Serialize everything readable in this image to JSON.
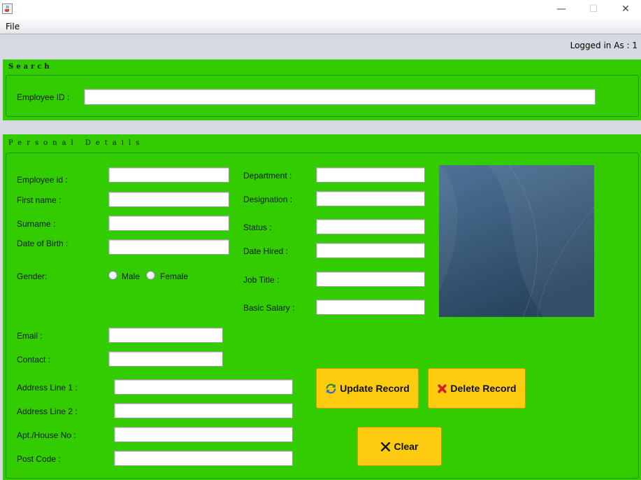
{
  "menu": {
    "file": "File"
  },
  "status": {
    "logged_in": "Logged in As :  1"
  },
  "search": {
    "legend": "Search",
    "employee_id_label": "Employee ID :",
    "employee_id_value": ""
  },
  "personal": {
    "legend": "Personal Details",
    "labels": {
      "employee_id": "Employee id :",
      "first_name": "First name :",
      "surname": "Surname :",
      "dob": "Date of Birth :",
      "gender": "Gender:",
      "male": "Male",
      "female": "Female",
      "email": "Email :",
      "contact": "Contact :",
      "address1": "Address Line 1 :",
      "address2": "Address Line 2 :",
      "apt": "Apt./House No :",
      "post_code": "Post Code :",
      "department": "Department :",
      "designation": "Designation :",
      "status": "Status :",
      "date_hired": "Date Hired :",
      "job_title": "Job Title :",
      "basic_salary": "Basic Salary :"
    },
    "values": {
      "employee_id": "",
      "first_name": "",
      "surname": "",
      "dob": "",
      "email": "",
      "contact": "",
      "address1": "",
      "address2": "",
      "apt": "",
      "post_code": "",
      "department": "",
      "designation": "",
      "status": "",
      "date_hired": "",
      "job_title": "",
      "basic_salary": ""
    },
    "gender_selected": ""
  },
  "buttons": {
    "update": "Update Record",
    "delete": "Delete Record",
    "clear": "Clear"
  },
  "icons": {
    "app": "java-cup-icon",
    "update": "refresh-icon",
    "delete": "red-x-icon",
    "clear": "black-x-icon"
  },
  "colors": {
    "panel": "#33cc00",
    "button": "#fdcc10",
    "photo": "#3f6383"
  }
}
